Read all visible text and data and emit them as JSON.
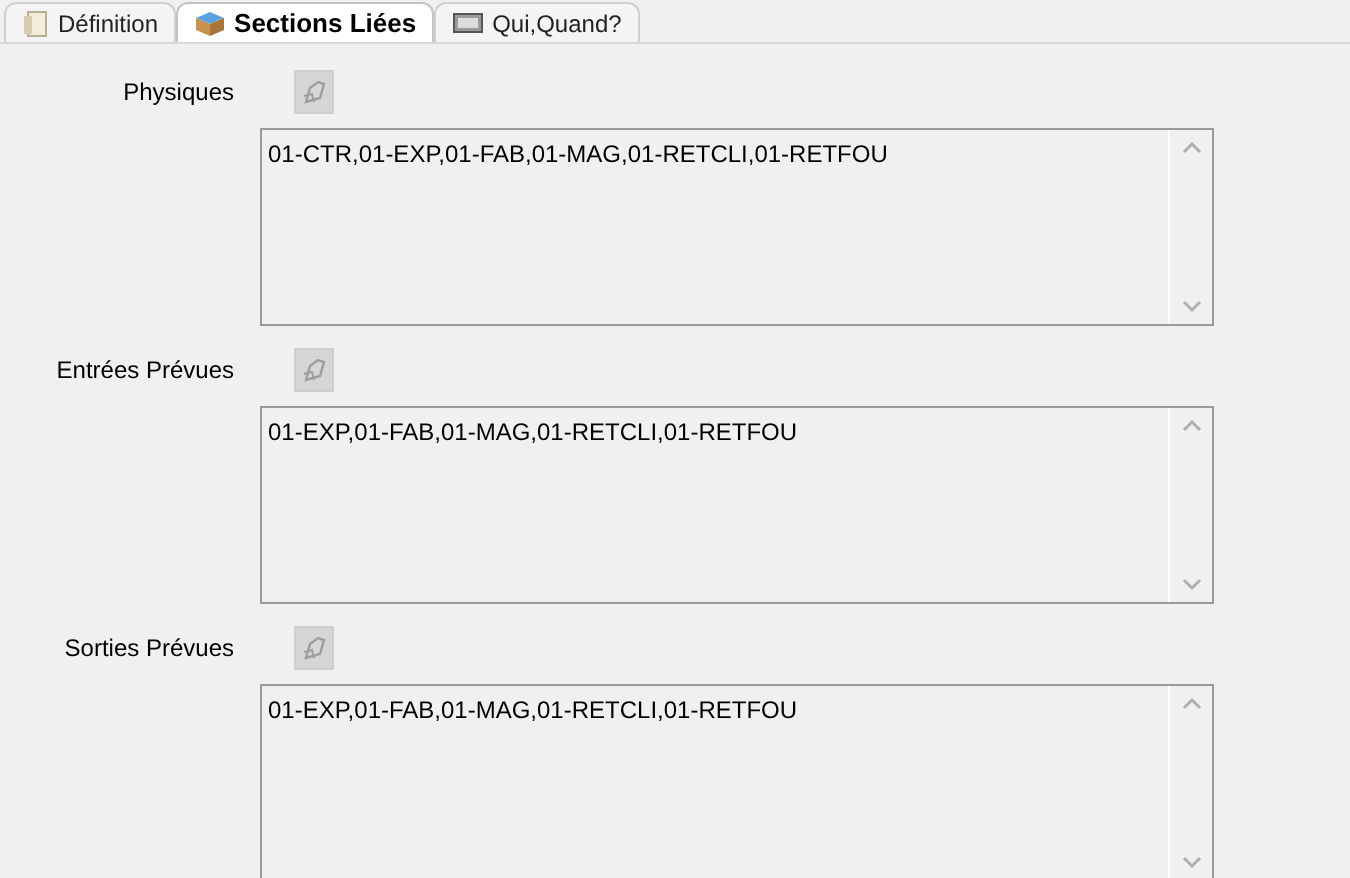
{
  "tabs": [
    {
      "label": "Définition",
      "selected": false
    },
    {
      "label": "Sections Liées",
      "selected": true
    },
    {
      "label": "Qui,Quand?",
      "selected": false
    }
  ],
  "sections": [
    {
      "label": "Physiques",
      "value": "01-CTR,01-EXP,01-FAB,01-MAG,01-RETCLI,01-RETFOU"
    },
    {
      "label": "Entrées Prévues",
      "value": "01-EXP,01-FAB,01-MAG,01-RETCLI,01-RETFOU"
    },
    {
      "label": "Sorties Prévues",
      "value": "01-EXP,01-FAB,01-MAG,01-RETCLI,01-RETFOU"
    }
  ]
}
